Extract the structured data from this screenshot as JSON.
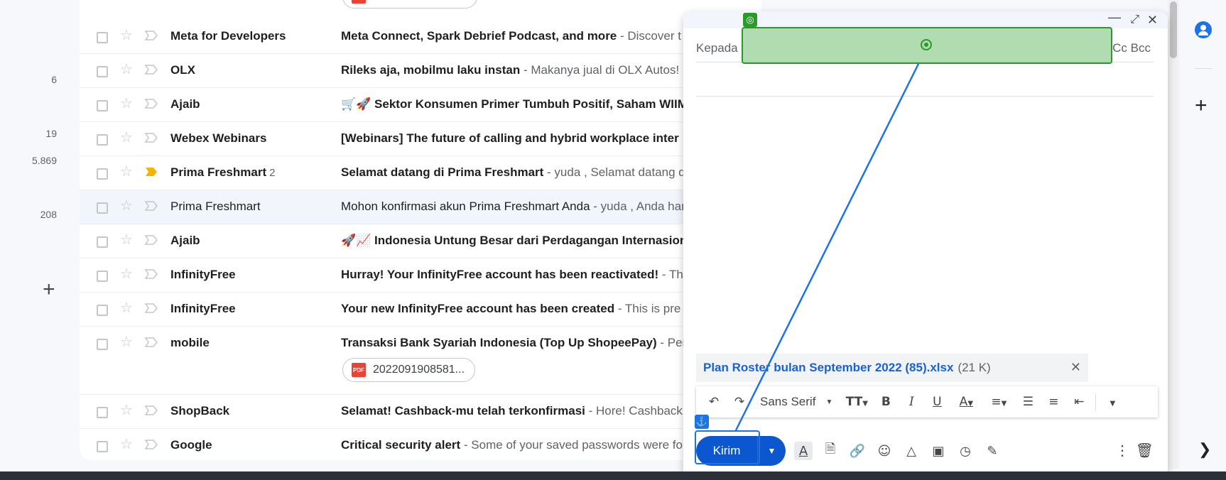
{
  "left_counts": [
    "6",
    "19",
    "5.869",
    "208"
  ],
  "emails": [
    {
      "sender": "Meta for Developers",
      "thread": "",
      "subject": "Meta Connect, Spark Debrief Podcast, and more",
      "preview": " - Discover t",
      "read": false,
      "important": false
    },
    {
      "sender": "OLX",
      "thread": "",
      "subject": "Rileks aja, mobilmu laku instan",
      "preview": " - Makanya jual di OLX Autos! M",
      "read": false,
      "important": false
    },
    {
      "sender": "Ajaib",
      "thread": "",
      "subject": "🛒🚀 Sektor Konsumen Primer Tumbuh Positif, Saham WIIM",
      "preview": "",
      "read": false,
      "important": false
    },
    {
      "sender": "Webex Webinars",
      "thread": "",
      "subject": "[Webinars] The future of calling and hybrid workplace inter",
      "preview": "",
      "read": false,
      "important": false
    },
    {
      "sender": "Prima Freshmart",
      "thread": "2",
      "subject": "Selamat datang di Prima Freshmart",
      "preview": " - yuda , Selamat datang d",
      "read": false,
      "important": true
    },
    {
      "sender": "Prima Freshmart",
      "thread": "",
      "subject": "Mohon konfirmasi akun Prima Freshmart Anda",
      "preview": " - yuda , Anda har",
      "read": true,
      "important": false
    },
    {
      "sender": "Ajaib",
      "thread": "",
      "subject": "🚀📈 Indonesia Untung Besar dari Perdagangan Internasion",
      "preview": "",
      "read": false,
      "important": false
    },
    {
      "sender": "InfinityFree",
      "thread": "",
      "subject": "Hurray! Your InfinityFree account has been reactivated!",
      "preview": " - Th",
      "read": false,
      "important": false
    },
    {
      "sender": "InfinityFree",
      "thread": "",
      "subject": "Your new InfinityFree account has been created",
      "preview": " - This is pre",
      "read": false,
      "important": false
    },
    {
      "sender": "mobile",
      "thread": "",
      "subject": "Transaksi Bank Syariah Indonesia (Top Up ShopeePay)",
      "preview": " - Per",
      "read": false,
      "important": false,
      "attachment": "2022091908581..."
    },
    {
      "sender": "ShopBack",
      "thread": "",
      "subject": "Selamat! Cashback-mu telah terkonfirmasi",
      "preview": " - Hore! Cashback",
      "read": false,
      "important": false
    },
    {
      "sender": "Google",
      "thread": "",
      "subject": "Critical security alert",
      "preview": " - Some of your saved passwords were fo",
      "read": false,
      "important": false
    }
  ],
  "compose": {
    "to_label": "Kepada",
    "cc_bcc": "Cc Bcc",
    "attachment_name": "Plan Roster bulan September 2022 (85).xlsx",
    "attachment_size": "(21 K)",
    "font": "Sans Serif",
    "send_label": "Kirim"
  },
  "icons": {
    "minimize": "minimize-icon",
    "expand": "expand-icon",
    "close": "close-icon"
  },
  "colors": {
    "send_blue": "#0b57d0",
    "attachment_link": "#1a62d2",
    "important_marker": "#f4b400",
    "overlay_target": "#2a9a2a",
    "overlay_source": "#1a73e8"
  }
}
